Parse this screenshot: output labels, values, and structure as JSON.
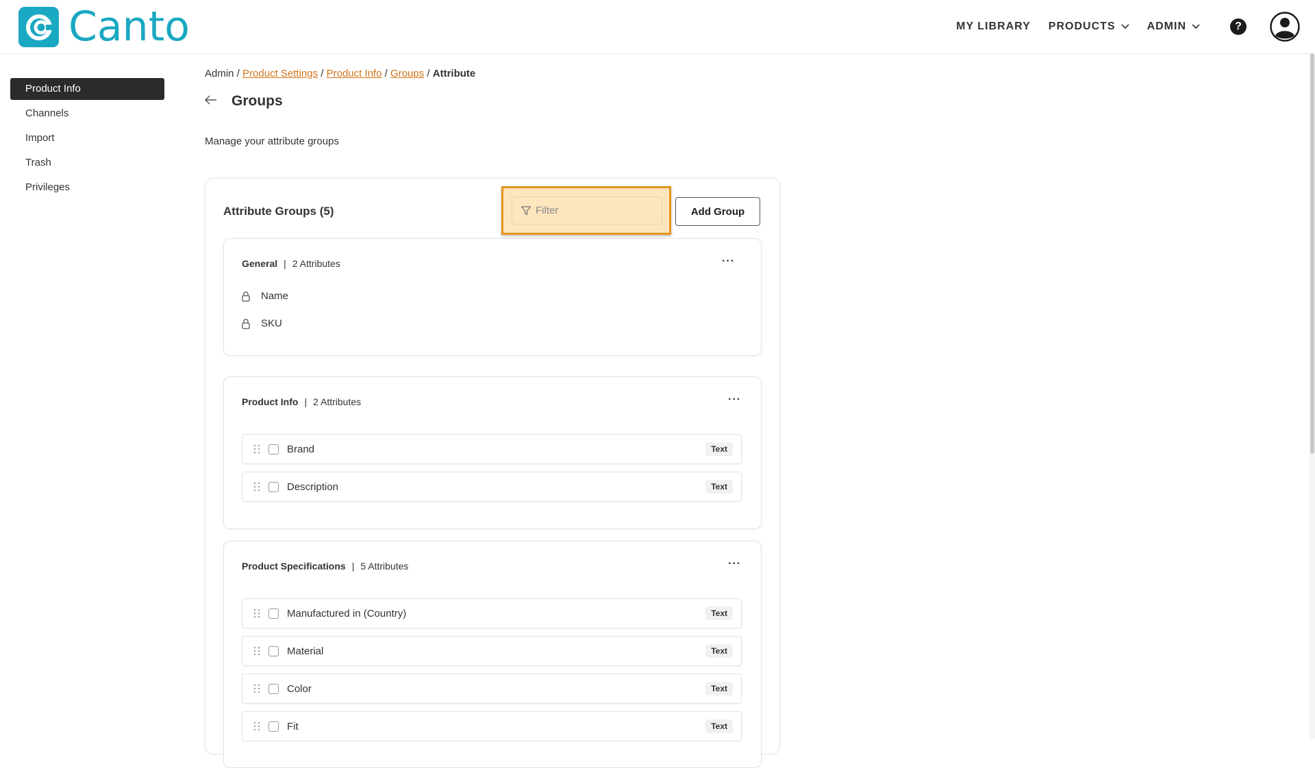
{
  "brand": {
    "name": "Canto",
    "color": "#1aa8c2"
  },
  "topnav": {
    "my_library": "MY LIBRARY",
    "products": "PRODUCTS",
    "admin": "ADMIN",
    "help": "?"
  },
  "sidebar": {
    "items": [
      {
        "label": "Product Info",
        "active": true
      },
      {
        "label": "Channels"
      },
      {
        "label": "Import"
      },
      {
        "label": "Trash"
      },
      {
        "label": "Privileges"
      }
    ]
  },
  "breadcrumb": {
    "root": "Admin",
    "sep": " / ",
    "links": [
      "Product Settings",
      "Product Info",
      "Groups"
    ],
    "current": "Attribute"
  },
  "page": {
    "title": "Groups",
    "subtitle": "Manage your attribute groups"
  },
  "panel": {
    "title": "Attribute Groups (5)",
    "filter_placeholder": "Filter",
    "add_group": "Add Group"
  },
  "groups": [
    {
      "name": "General",
      "count": "2 Attributes",
      "locked_attributes": [
        "Name",
        "SKU"
      ]
    },
    {
      "name": "Product Info",
      "count": "2 Attributes",
      "attributes": [
        {
          "name": "Brand",
          "type": "Text"
        },
        {
          "name": "Description",
          "type": "Text"
        }
      ]
    },
    {
      "name": "Product Specifications",
      "count": "5 Attributes",
      "attributes": [
        {
          "name": "Manufactured in (Country)",
          "type": "Text"
        },
        {
          "name": "Material",
          "type": "Text"
        },
        {
          "name": "Color",
          "type": "Text"
        },
        {
          "name": "Fit",
          "type": "Text"
        }
      ]
    }
  ],
  "highlight_color": "#e6951e"
}
